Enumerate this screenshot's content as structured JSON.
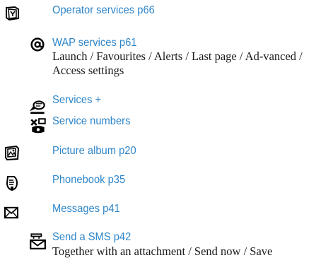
{
  "accent_color": "#2e86c9",
  "entries": [
    {
      "icon": "operator-services-icon",
      "title": "Operator services p66",
      "description": ""
    },
    {
      "icon": "at-sign-icon",
      "title": "WAP services p61",
      "description": "Launch / Favourites / Alerts / Last page / Ad-vanced / Access settings"
    },
    {
      "icon": "services-plus-icon",
      "title": "Services +",
      "description": ""
    },
    {
      "icon": "service-numbers-icon",
      "title": "Service numbers",
      "description": ""
    },
    {
      "icon": "picture-album-icon",
      "title": "Picture album p20",
      "description": ""
    },
    {
      "icon": "phonebook-icon",
      "title": "Phonebook p35",
      "description": ""
    },
    {
      "icon": "envelope-icon",
      "title": "Messages p41",
      "description": ""
    },
    {
      "icon": "send-sms-icon",
      "title": "Send a SMS p42",
      "description": "Together with an attachment / Send now / Save"
    }
  ]
}
